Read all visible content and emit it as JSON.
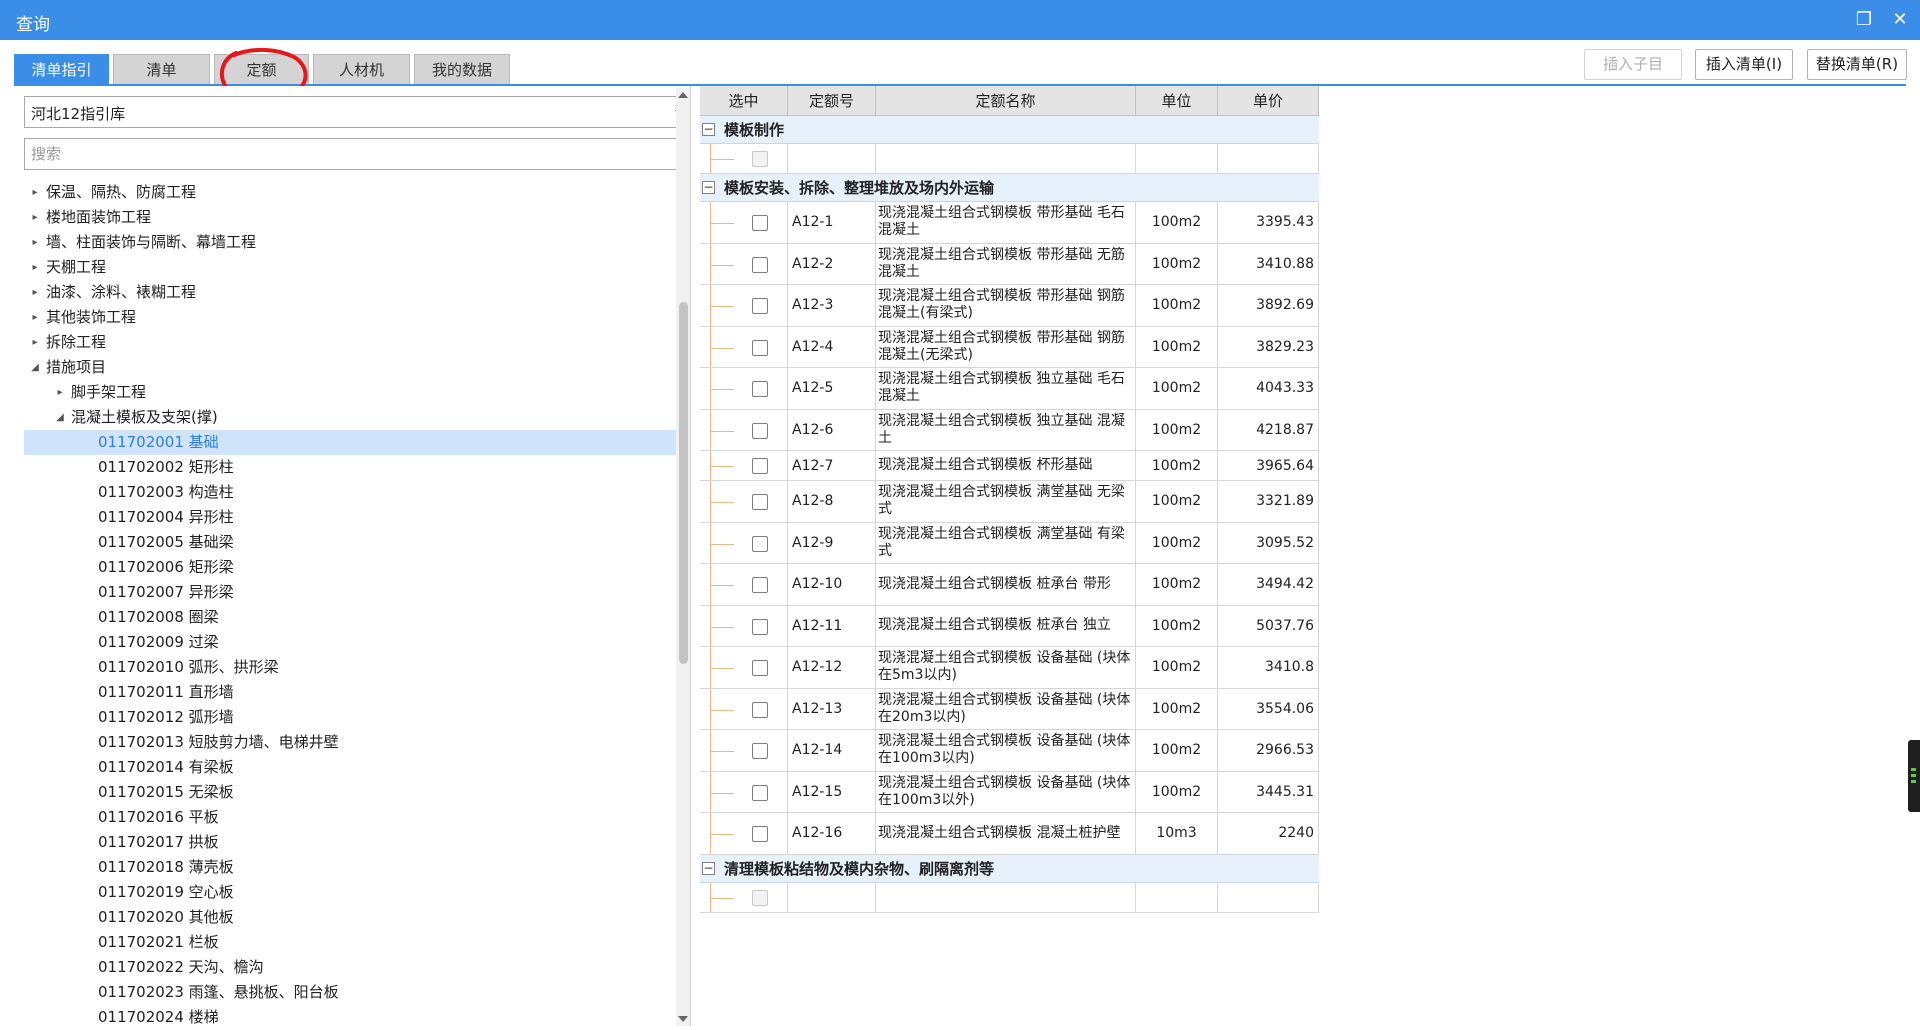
{
  "window": {
    "title": "查询",
    "restore_icon": "restore-icon",
    "close_icon": "close-icon"
  },
  "tabs": [
    {
      "label": "清单指引",
      "active": true
    },
    {
      "label": "清单",
      "active": false
    },
    {
      "label": "定额",
      "active": false
    },
    {
      "label": "人材机",
      "active": false
    },
    {
      "label": "我的数据",
      "active": false
    }
  ],
  "toolbar": {
    "insert_child": "插入子目",
    "insert_list": "插入清单(I)",
    "replace_list": "替换清单(R)"
  },
  "left": {
    "library": "河北12指引库",
    "search_placeholder": "搜索",
    "tree": [
      {
        "label": "保温、隔热、防腐工程",
        "level": 0,
        "toggle": "▸"
      },
      {
        "label": "楼地面装饰工程",
        "level": 0,
        "toggle": "▸"
      },
      {
        "label": "墙、柱面装饰与隔断、幕墙工程",
        "level": 0,
        "toggle": "▸"
      },
      {
        "label": "天棚工程",
        "level": 0,
        "toggle": "▸"
      },
      {
        "label": "油漆、涂料、裱糊工程",
        "level": 0,
        "toggle": "▸"
      },
      {
        "label": "其他装饰工程",
        "level": 0,
        "toggle": "▸"
      },
      {
        "label": "拆除工程",
        "level": 0,
        "toggle": "▸"
      },
      {
        "label": "措施项目",
        "level": 0,
        "toggle": "◢"
      },
      {
        "label": "脚手架工程",
        "level": 1,
        "toggle": "▸"
      },
      {
        "label": "混凝土模板及支架(撑)",
        "level": 1,
        "toggle": "◢"
      },
      {
        "label": "011702001  基础",
        "level": 2,
        "toggle": "",
        "selected": true
      },
      {
        "label": "011702002  矩形柱",
        "level": 2,
        "toggle": ""
      },
      {
        "label": "011702003  构造柱",
        "level": 2,
        "toggle": ""
      },
      {
        "label": "011702004  异形柱",
        "level": 2,
        "toggle": ""
      },
      {
        "label": "011702005  基础梁",
        "level": 2,
        "toggle": ""
      },
      {
        "label": "011702006  矩形梁",
        "level": 2,
        "toggle": ""
      },
      {
        "label": "011702007  异形梁",
        "level": 2,
        "toggle": ""
      },
      {
        "label": "011702008  圈梁",
        "level": 2,
        "toggle": ""
      },
      {
        "label": "011702009  过梁",
        "level": 2,
        "toggle": ""
      },
      {
        "label": "011702010  弧形、拱形梁",
        "level": 2,
        "toggle": ""
      },
      {
        "label": "011702011  直形墙",
        "level": 2,
        "toggle": ""
      },
      {
        "label": "011702012  弧形墙",
        "level": 2,
        "toggle": ""
      },
      {
        "label": "011702013  短肢剪力墙、电梯井壁",
        "level": 2,
        "toggle": ""
      },
      {
        "label": "011702014  有梁板",
        "level": 2,
        "toggle": ""
      },
      {
        "label": "011702015  无梁板",
        "level": 2,
        "toggle": ""
      },
      {
        "label": "011702016  平板",
        "level": 2,
        "toggle": ""
      },
      {
        "label": "011702017  拱板",
        "level": 2,
        "toggle": ""
      },
      {
        "label": "011702018  薄壳板",
        "level": 2,
        "toggle": ""
      },
      {
        "label": "011702019  空心板",
        "level": 2,
        "toggle": ""
      },
      {
        "label": "011702020  其他板",
        "level": 2,
        "toggle": ""
      },
      {
        "label": "011702021  栏板",
        "level": 2,
        "toggle": ""
      },
      {
        "label": "011702022  天沟、檐沟",
        "level": 2,
        "toggle": ""
      },
      {
        "label": "011702023  雨篷、悬挑板、阳台板",
        "level": 2,
        "toggle": ""
      },
      {
        "label": "011702024  楼梯",
        "level": 2,
        "toggle": ""
      }
    ]
  },
  "table": {
    "headers": [
      "选中",
      "定额号",
      "定额名称",
      "单位",
      "单价"
    ],
    "groups": [
      {
        "name": "模板制作",
        "rows": [
          {
            "code": "",
            "name": "",
            "unit": "",
            "price": "",
            "empty": true
          }
        ]
      },
      {
        "name": "模板安装、拆除、整理堆放及场内外运输",
        "rows": [
          {
            "code": "A12-1",
            "name": "现浇混凝土组合式钢模板 带形基础 毛石混凝土",
            "unit": "100m2",
            "price": "3395.43"
          },
          {
            "code": "A12-2",
            "name": "现浇混凝土组合式钢模板 带形基础 无筋混凝土",
            "unit": "100m2",
            "price": "3410.88"
          },
          {
            "code": "A12-3",
            "name": "现浇混凝土组合式钢模板 带形基础 钢筋混凝土(有梁式)",
            "unit": "100m2",
            "price": "3892.69"
          },
          {
            "code": "A12-4",
            "name": "现浇混凝土组合式钢模板 带形基础 钢筋混凝土(无梁式)",
            "unit": "100m2",
            "price": "3829.23"
          },
          {
            "code": "A12-5",
            "name": "现浇混凝土组合式钢模板 独立基础 毛石混凝土",
            "unit": "100m2",
            "price": "4043.33"
          },
          {
            "code": "A12-6",
            "name": "现浇混凝土组合式钢模板 独立基础 混凝土",
            "unit": "100m2",
            "price": "4218.87"
          },
          {
            "code": "A12-7",
            "name": "现浇混凝土组合式钢模板 杯形基础",
            "unit": "100m2",
            "price": "3965.64"
          },
          {
            "code": "A12-8",
            "name": "现浇混凝土组合式钢模板 满堂基础 无梁式",
            "unit": "100m2",
            "price": "3321.89"
          },
          {
            "code": "A12-9",
            "name": "现浇混凝土组合式钢模板 满堂基础 有梁式",
            "unit": "100m2",
            "price": "3095.52"
          },
          {
            "code": "A12-10",
            "name": "现浇混凝土组合式钢模板 桩承台 带形",
            "unit": "100m2",
            "price": "3494.42"
          },
          {
            "code": "A12-11",
            "name": "现浇混凝土组合式钢模板 桩承台 独立",
            "unit": "100m2",
            "price": "5037.76"
          },
          {
            "code": "A12-12",
            "name": "现浇混凝土组合式钢模板 设备基础 (块体在5m3以内)",
            "unit": "100m2",
            "price": "3410.8"
          },
          {
            "code": "A12-13",
            "name": "现浇混凝土组合式钢模板 设备基础 (块体在20m3以内)",
            "unit": "100m2",
            "price": "3554.06"
          },
          {
            "code": "A12-14",
            "name": "现浇混凝土组合式钢模板 设备基础 (块体在100m3以内)",
            "unit": "100m2",
            "price": "2966.53"
          },
          {
            "code": "A12-15",
            "name": "现浇混凝土组合式钢模板 设备基础 (块体在100m3以外)",
            "unit": "100m2",
            "price": "3445.31"
          },
          {
            "code": "A12-16",
            "name": "现浇混凝土组合式钢模板 混凝土桩护壁",
            "unit": "10m3",
            "price": "2240"
          }
        ]
      },
      {
        "name": "清理模板粘结物及模内杂物、刷隔离剂等",
        "rows": [
          {
            "code": "",
            "name": "",
            "unit": "",
            "price": "",
            "empty": true
          }
        ]
      }
    ]
  },
  "colors": {
    "accent": "#3b8ee8",
    "annotation": "#e8161b",
    "selected_row": "#cfe3fb"
  }
}
